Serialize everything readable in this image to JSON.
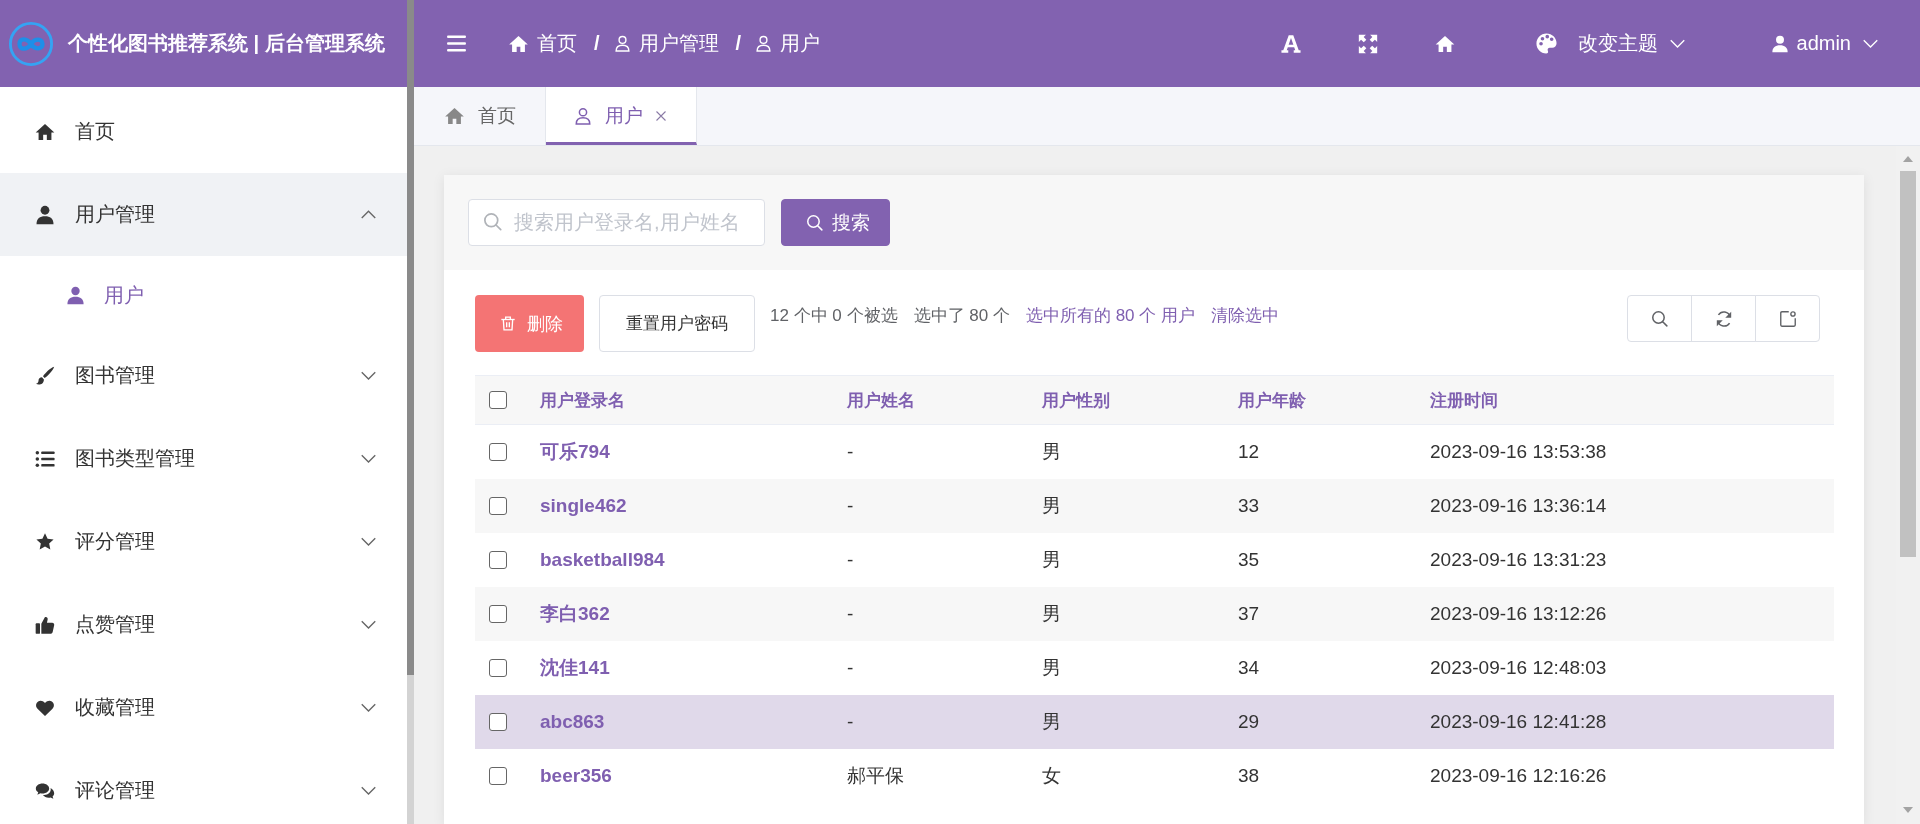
{
  "brand": {
    "title": "个性化图书推荐系统 | 后台管理系统"
  },
  "sidebar": {
    "items": [
      {
        "kind": "link",
        "label": "首页",
        "selected": false
      },
      {
        "kind": "group",
        "label": "用户管理",
        "selected": false,
        "expanded": true,
        "children": [
          {
            "label": "用户",
            "selected": true
          }
        ]
      },
      {
        "kind": "group",
        "label": "图书管理",
        "selected": false,
        "expanded": false
      },
      {
        "kind": "group",
        "label": "图书类型管理",
        "selected": false,
        "expanded": false
      },
      {
        "kind": "group",
        "label": "评分管理",
        "selected": false,
        "expanded": false
      },
      {
        "kind": "group",
        "label": "点赞管理",
        "selected": false,
        "expanded": false
      },
      {
        "kind": "group",
        "label": "收藏管理",
        "selected": false,
        "expanded": false
      },
      {
        "kind": "group",
        "label": "评论管理",
        "selected": false,
        "expanded": false
      }
    ]
  },
  "top_bar": {
    "breadcrumb": [
      {
        "label": "首页",
        "separator": "/"
      },
      {
        "label": "用户管理",
        "separator": "/"
      },
      {
        "label": "用户"
      }
    ],
    "theme_menu": {
      "label": "改变主题"
    },
    "user_menu": {
      "label": "admin"
    }
  },
  "tabs": [
    {
      "label": "首页",
      "selected": false,
      "closable": false
    },
    {
      "label": "用户",
      "selected": true,
      "closable": true
    }
  ],
  "search": {
    "placeholder": "搜索用户登录名,用户姓名",
    "button": "搜索"
  },
  "actions": {
    "delete_button": "删除",
    "reset_button": "重置用户密码",
    "selection_count": "12 个中 0 个被选",
    "selected_total": "选中了 80 个",
    "select_all_link": "选中所有的 80 个 用户",
    "clear_link": "清除选中"
  },
  "table": {
    "all_checked": false,
    "columns": [
      "用户登录名",
      "用户姓名",
      "用户性别",
      "用户年龄",
      "注册时间"
    ],
    "rows": [
      {
        "checked": false,
        "hovered": false,
        "cells": [
          "可乐794",
          "-",
          "男",
          "12",
          "2023-09-16 13:53:38"
        ]
      },
      {
        "checked": false,
        "hovered": false,
        "cells": [
          "single462",
          "-",
          "男",
          "33",
          "2023-09-16 13:36:14"
        ]
      },
      {
        "checked": false,
        "hovered": false,
        "cells": [
          "basketball984",
          "-",
          "男",
          "35",
          "2023-09-16 13:31:23"
        ]
      },
      {
        "checked": false,
        "hovered": false,
        "cells": [
          "李白362",
          "-",
          "男",
          "37",
          "2023-09-16 13:12:26"
        ]
      },
      {
        "checked": false,
        "hovered": false,
        "cells": [
          "沈佳141",
          "-",
          "男",
          "34",
          "2023-09-16 12:48:03"
        ]
      },
      {
        "checked": false,
        "hovered": true,
        "cells": [
          "abc863",
          "-",
          "男",
          "29",
          "2023-09-16 12:41:28"
        ]
      },
      {
        "checked": false,
        "hovered": false,
        "cells": [
          "beer356",
          "郝平保",
          "女",
          "38",
          "2023-09-16 12:16:26"
        ]
      }
    ]
  }
}
